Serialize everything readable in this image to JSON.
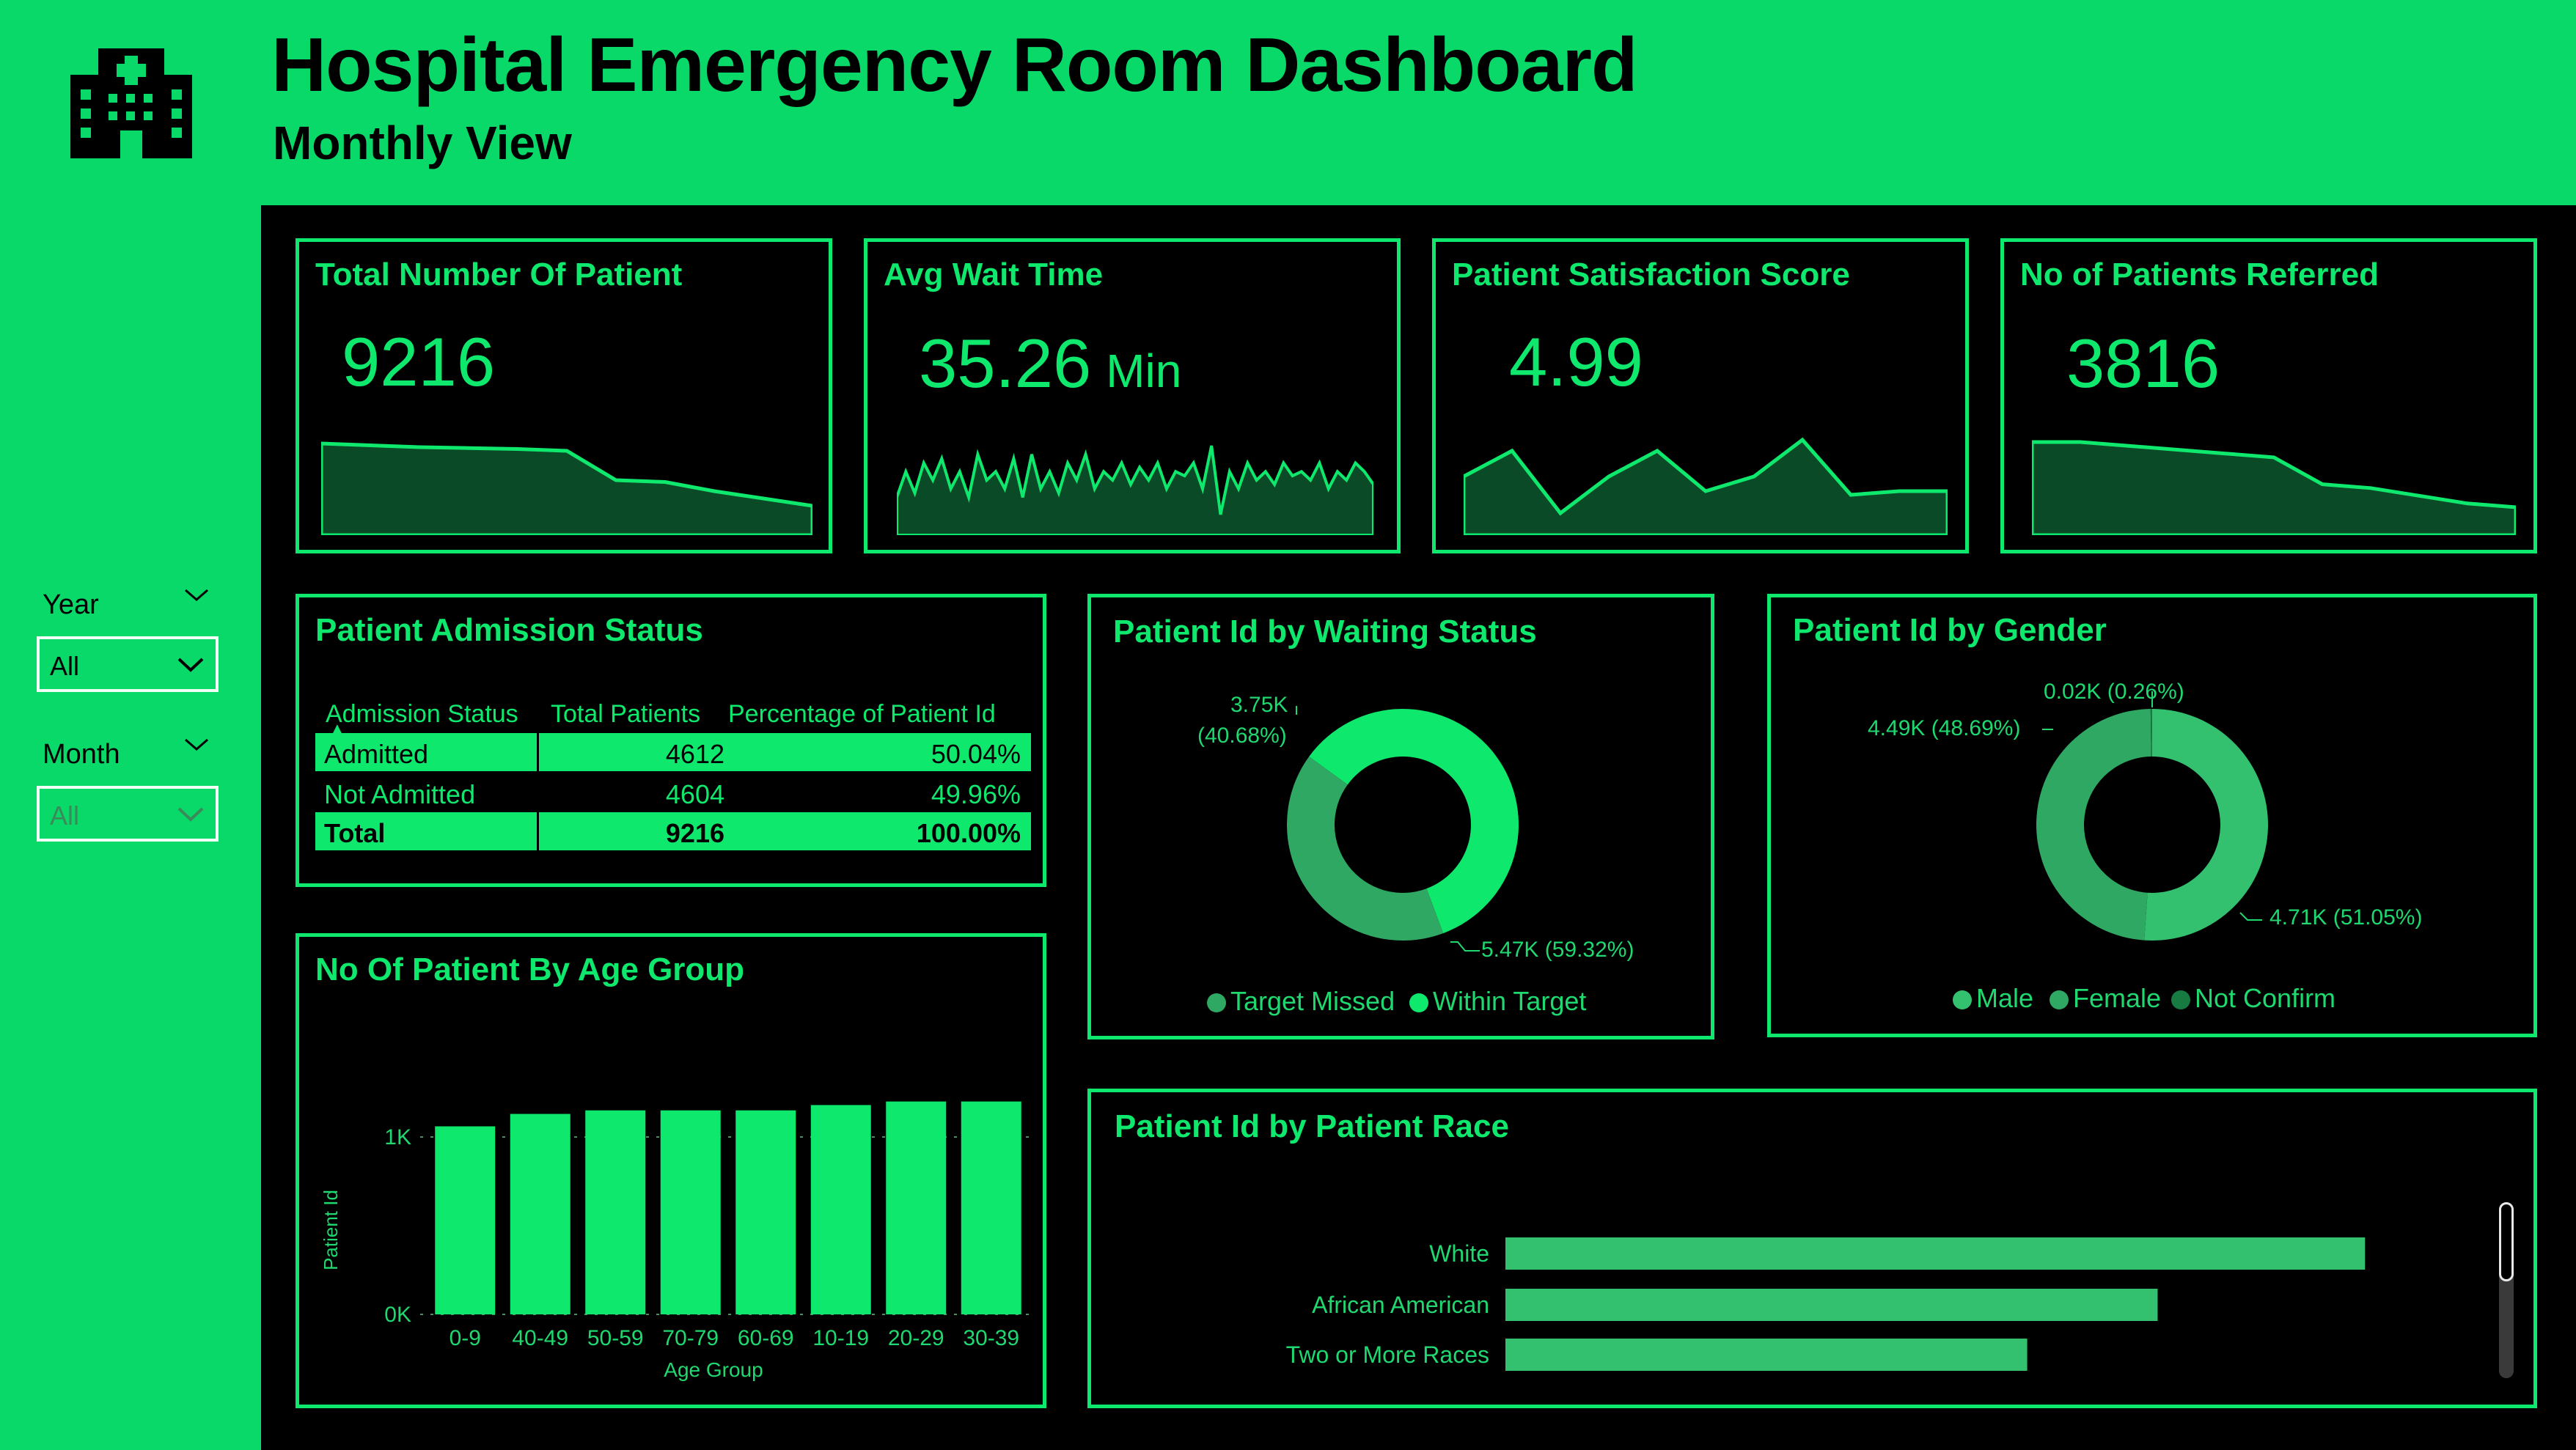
{
  "header": {
    "title": "Hospital Emergency Room Dashboard",
    "subtitle": "Monthly View",
    "icon": "hospital-icon"
  },
  "filters": {
    "year": {
      "label": "Year",
      "value": "All"
    },
    "month": {
      "label": "Month",
      "value": "All"
    }
  },
  "kpis": {
    "total_patients": {
      "title": "Total Number Of Patient",
      "value": "9216"
    },
    "avg_wait": {
      "title": "Avg Wait Time",
      "value": "35.26",
      "unit": "Min"
    },
    "satisfaction": {
      "title": "Patient Satisfaction Score",
      "value": "4.99"
    },
    "referred": {
      "title": "No of Patients Referred",
      "value": "3816"
    }
  },
  "admission": {
    "title": "Patient Admission Status",
    "headers": [
      "Admission Status",
      "Total Patients",
      "Percentage of Patient Id"
    ],
    "rows": [
      {
        "status": "Admitted",
        "total": "4612",
        "pct": "50.04%"
      },
      {
        "status": "Not Admitted",
        "total": "4604",
        "pct": "49.96%"
      },
      {
        "status": "Total",
        "total": "9216",
        "pct": "100.00%"
      }
    ]
  },
  "waiting": {
    "title": "Patient Id by Waiting Status",
    "label_a_line1": "3.75K",
    "label_a_line2": "(40.68%)",
    "label_b": "5.47K (59.32%)",
    "legend": [
      "Target Missed",
      "Within Target"
    ]
  },
  "gender": {
    "title": "Patient Id by Gender",
    "label_nc": "0.02K (0.26%)",
    "label_f": "4.49K (48.69%)",
    "label_m": "4.71K (51.05%)",
    "legend": [
      "Male",
      "Female",
      "Not Confirm"
    ]
  },
  "age_panel": {
    "title": "No Of Patient By Age Group"
  },
  "race_panel": {
    "title": "Patient Id by Patient Race"
  },
  "colors": {
    "background": "#08d968",
    "accent": "#0ee96d",
    "dark_green": "#0b4a27",
    "muted_green": "#2fa863",
    "mid_green": "#33c170"
  },
  "chart_data": [
    {
      "type": "bar",
      "title": "No Of Patient By Age Group",
      "xlabel": "Age Group",
      "ylabel": "Patient Id",
      "categories": [
        "0-9",
        "40-49",
        "50-59",
        "70-79",
        "60-69",
        "10-19",
        "20-29",
        "30-39"
      ],
      "values": [
        1060,
        1130,
        1150,
        1150,
        1150,
        1180,
        1200,
        1200
      ],
      "ylim": [
        0,
        1300
      ],
      "yticks": [
        "0K",
        "1K"
      ]
    },
    {
      "type": "bar",
      "orientation": "horizontal",
      "title": "Patient Id by Patient Race",
      "categories": [
        "White",
        "African American",
        "Two or More Races"
      ],
      "values": [
        2570,
        1950,
        1560
      ],
      "xlim": [
        0,
        2850
      ]
    },
    {
      "type": "pie",
      "donut": true,
      "title": "Patient Id by Waiting Status",
      "labels": [
        "Target Missed",
        "Within Target"
      ],
      "values": [
        3750,
        5470
      ],
      "percentages": [
        40.68,
        59.32
      ]
    },
    {
      "type": "pie",
      "donut": true,
      "title": "Patient Id by Gender",
      "labels": [
        "Male",
        "Female",
        "Not Confirm"
      ],
      "values": [
        4710,
        4490,
        20
      ],
      "percentages": [
        51.05,
        48.69,
        0.26
      ]
    },
    {
      "type": "area",
      "title": "Total Number Of Patient",
      "values": [
        820,
        810,
        800,
        795,
        790,
        780,
        620,
        610,
        560,
        520,
        480
      ]
    },
    {
      "type": "line",
      "title": "Avg Wait Time",
      "values": [
        33,
        36,
        33.5,
        37,
        35,
        37.5,
        34,
        36,
        33,
        38,
        35,
        36,
        34,
        37.5,
        33,
        38,
        34,
        36,
        33.5,
        37,
        35,
        38,
        34,
        36,
        35,
        37,
        34.5,
        36.5,
        35,
        37,
        34,
        36,
        35.5,
        37,
        34,
        39,
        31,
        36,
        34,
        37,
        35,
        36,
        34.5,
        37,
        35.5,
        36,
        35,
        37,
        34,
        36,
        35,
        37,
        36,
        34.5
      ]
    },
    {
      "type": "area",
      "title": "Patient Satisfaction Score",
      "values": [
        5.0,
        5.7,
        4.0,
        5.0,
        5.7,
        4.6,
        5.0,
        6.0,
        4.5,
        4.6,
        4.6
      ]
    },
    {
      "type": "area",
      "title": "No of Patients Referred",
      "values": [
        340,
        340,
        330,
        320,
        310,
        300,
        230,
        220,
        200,
        180,
        170
      ]
    }
  ]
}
